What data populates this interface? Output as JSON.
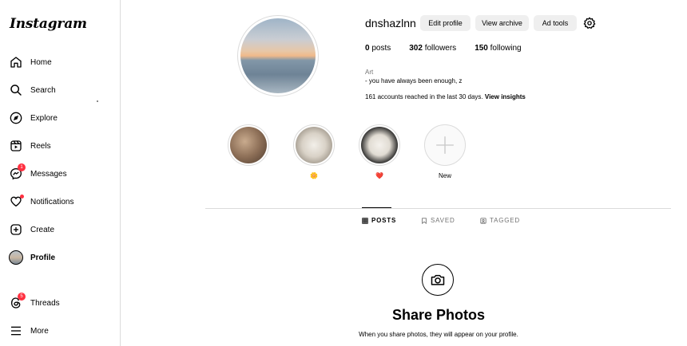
{
  "sidebar": {
    "logo": "Instagram",
    "items": [
      {
        "label": "Home",
        "icon": "home-icon"
      },
      {
        "label": "Search",
        "icon": "search-icon"
      },
      {
        "label": "Explore",
        "icon": "compass-icon"
      },
      {
        "label": "Reels",
        "icon": "reels-icon"
      },
      {
        "label": "Messages",
        "icon": "messenger-icon",
        "badge": "1"
      },
      {
        "label": "Notifications",
        "icon": "heart-icon"
      },
      {
        "label": "Create",
        "icon": "plus-square-icon"
      },
      {
        "label": "Profile",
        "icon": "avatar"
      },
      {
        "label": "Threads",
        "icon": "threads-icon",
        "badge": "5"
      },
      {
        "label": "More",
        "icon": "menu-icon"
      }
    ]
  },
  "profile": {
    "username": "dnshazlnn",
    "buttons": {
      "edit": "Edit profile",
      "archive": "View archive",
      "adtools": "Ad tools"
    },
    "stats": {
      "posts_count": "0",
      "posts_label": "posts",
      "followers_count": "302",
      "followers_label": "followers",
      "following_count": "150",
      "following_label": "following"
    },
    "category": "Art",
    "bio": "- you have always been enough, z",
    "reach_text": "161 accounts reached in the last 30 days.",
    "reach_link": "View insights"
  },
  "highlights": [
    {
      "label": ""
    },
    {
      "label": "🌼"
    },
    {
      "label": "❤️"
    },
    {
      "label": "New"
    }
  ],
  "tabs": [
    {
      "label": "POSTS",
      "icon": "grid-icon"
    },
    {
      "label": "SAVED",
      "icon": "bookmark-icon"
    },
    {
      "label": "TAGGED",
      "icon": "tag-icon"
    }
  ],
  "empty_state": {
    "title": "Share Photos",
    "subtitle": "When you share photos, they will appear on your profile."
  },
  "colors": {
    "badge": "#ff3040",
    "button_bg": "#efefef",
    "border": "#dbdbdb",
    "muted_text": "#737373"
  }
}
